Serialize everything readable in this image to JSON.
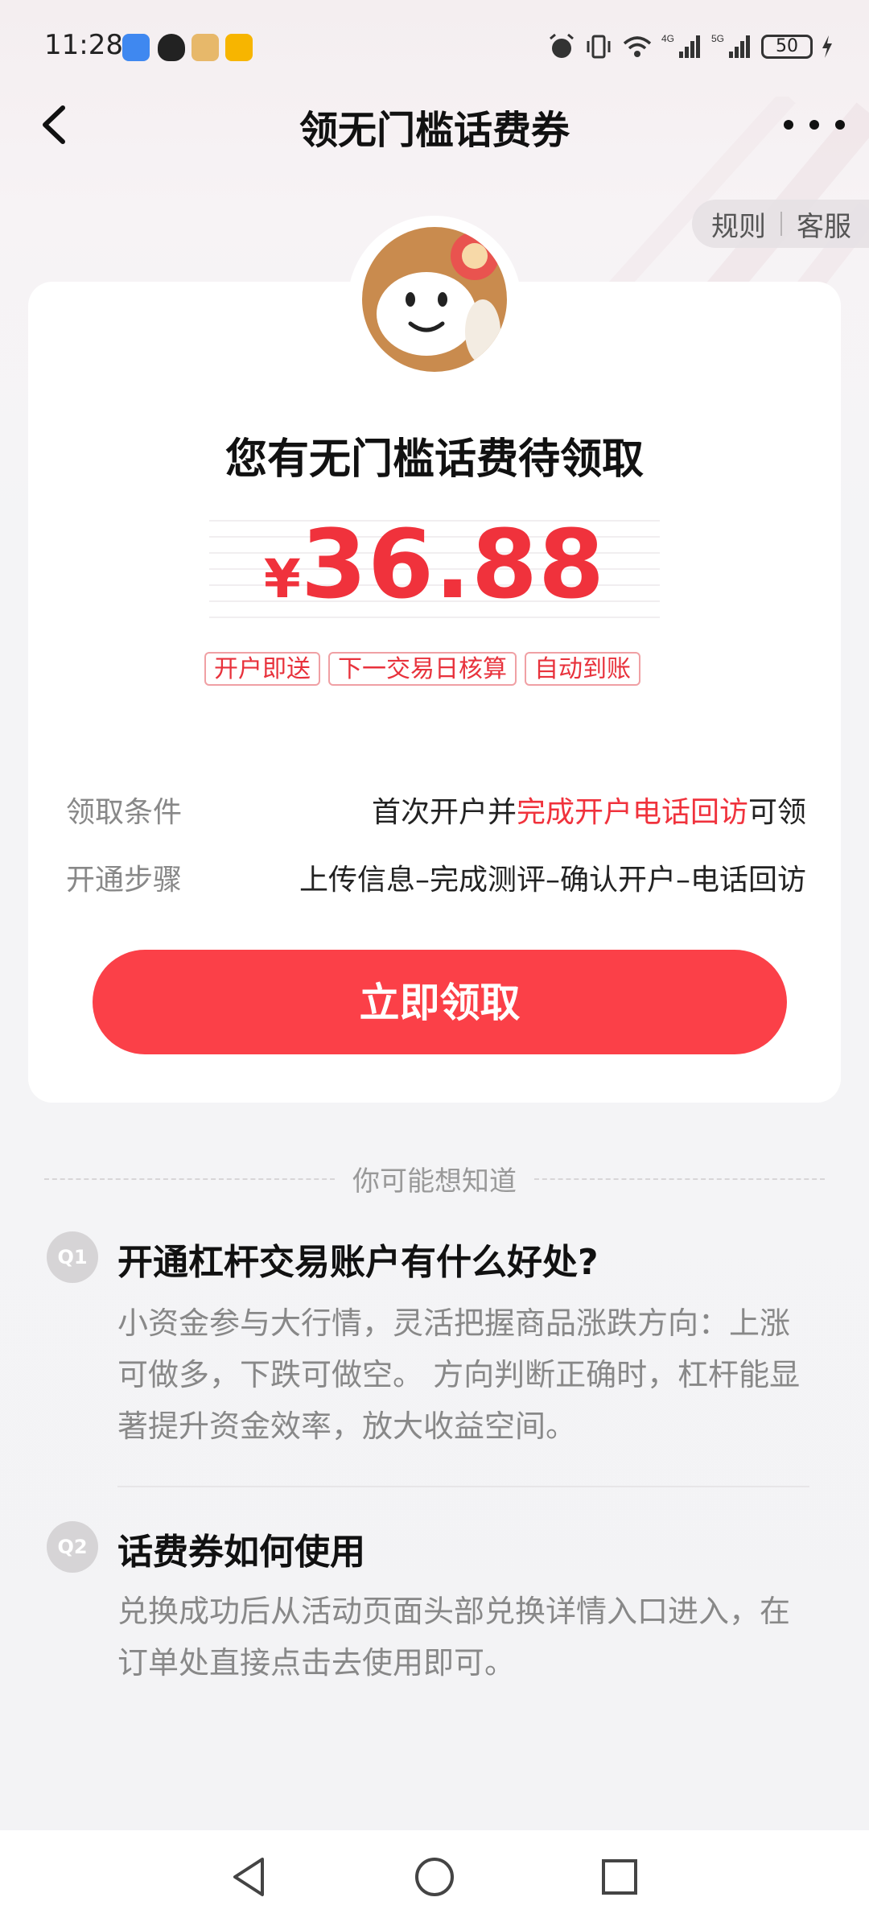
{
  "status_bar": {
    "time": "11:28",
    "battery": "50"
  },
  "nav": {
    "title": "领无门槛话费券"
  },
  "top_links": {
    "rules": "规则",
    "service": "客服"
  },
  "card": {
    "title": "您有无门槛话费待领取",
    "currency": "¥",
    "amount": "36.88",
    "tags": [
      "开户即送",
      "下一交易日核算",
      "自动到账"
    ],
    "conditions_label": "领取条件",
    "conditions_prefix": "首次开户并",
    "conditions_highlight": "完成开户电话回访",
    "conditions_suffix": "可领",
    "steps_label": "开通步骤",
    "steps_value": "上传信息–完成测评–确认开户–电话回访",
    "claim_button": "立即领取"
  },
  "faq": {
    "heading": "你可能想知道",
    "items": [
      {
        "badge": "Q1",
        "question": "开通杠杆交易账户有什么好处?",
        "answer": "小资金参与大行情，灵活把握商品涨跌方向：上涨可做多，下跌可做空。 方向判断正确时，杠杆能显著提升资金效率，放大收益空间。"
      },
      {
        "badge": "Q2",
        "question": "话费券如何使用",
        "answer": "兑换成功后从活动页面头部兑换详情入口进入，在订单处直接点击去使用即可。"
      }
    ]
  },
  "colors": {
    "accent": "#f0323c",
    "button": "#fb4048"
  }
}
